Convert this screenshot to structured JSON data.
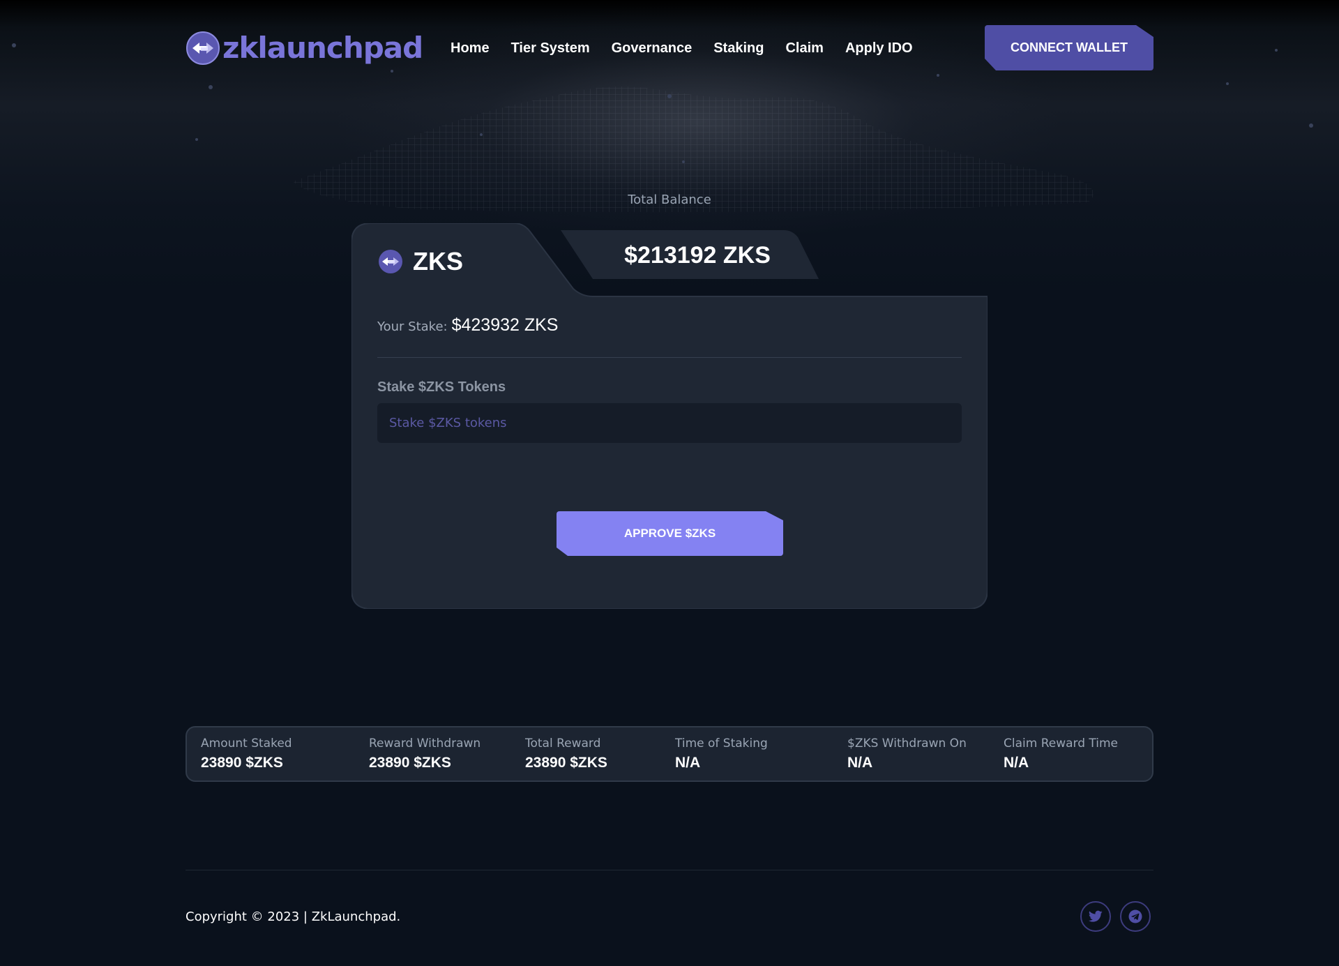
{
  "header": {
    "brand": "zklaunchpad",
    "nav": [
      "Home",
      "Tier System",
      "Governance",
      "Staking",
      "Claim",
      "Apply IDO"
    ],
    "connect_label": "CONNECT WALLET"
  },
  "balance": {
    "label": "Total Balance",
    "token": "ZKS",
    "amount": "$213192 ZKS"
  },
  "stake_form": {
    "your_stake_label": "Your Stake:",
    "your_stake_value": "$423932 ZKS",
    "section_title": "Stake $ZKS Tokens",
    "input_placeholder": "Stake $ZKS tokens",
    "input_value": "",
    "approve_label": "APPROVE $ZKS"
  },
  "stats": [
    {
      "label": "Amount Staked",
      "value": "23890 $ZKS"
    },
    {
      "label": "Reward Withdrawn",
      "value": "23890 $ZKS"
    },
    {
      "label": "Total Reward",
      "value": "23890 $ZKS"
    },
    {
      "label": "Time of Staking",
      "value": "N/A"
    },
    {
      "label": "$ZKS Withdrawn On",
      "value": "N/A"
    },
    {
      "label": "Claim Reward Time",
      "value": "N/A"
    }
  ],
  "footer": {
    "copyright": "Copyright © 2023 | ZkLaunchpad.",
    "socials": [
      "twitter-icon",
      "telegram-icon"
    ]
  },
  "colors": {
    "background": "#0a111c",
    "card": "#1f2734",
    "accent": "#8482f2",
    "brand": "#7a75d9",
    "connect": "#4f4ea5"
  }
}
